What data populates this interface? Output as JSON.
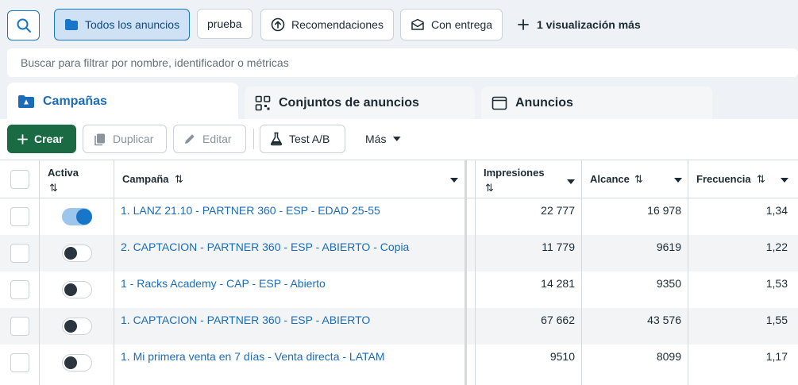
{
  "views": {
    "all_ads": "Todos los anuncios",
    "prueba": "prueba",
    "recomendaciones": "Recomendaciones",
    "con_entrega": "Con entrega",
    "more": "1 visualización más"
  },
  "filter": {
    "placeholder": "Buscar para filtrar por nombre, identificador o métricas"
  },
  "tabs": {
    "campaigns": "Campañas",
    "adsets": "Conjuntos de anuncios",
    "ads": "Anuncios"
  },
  "toolbar": {
    "create": "Crear",
    "duplicate": "Duplicar",
    "edit": "Editar",
    "abtest": "Test A/B",
    "more": "Más"
  },
  "table": {
    "headers": {
      "active": "Activa",
      "campaign": "Campaña",
      "impressions": "Impresiones",
      "reach": "Alcance",
      "frequency": "Frecuencia"
    },
    "sort_glyph": "⇅",
    "rows": [
      {
        "active": true,
        "campaign": "1. LANZ 21.10 - PARTNER 360 - ESP - EDAD 25-55",
        "impressions": "22 777",
        "reach": "16 978",
        "frequency": "1,34"
      },
      {
        "active": false,
        "campaign": "2. CAPTACION - PARTNER 360 - ESP - ABIERTO - Copia",
        "impressions": "11 779",
        "reach": "9619",
        "frequency": "1,22"
      },
      {
        "active": false,
        "campaign": "1 - Racks Academy - CAP - ESP - Abierto",
        "impressions": "14 281",
        "reach": "9350",
        "frequency": "1,53"
      },
      {
        "active": false,
        "campaign": "1. CAPTACION - PARTNER 360 - ESP - ABIERTO",
        "impressions": "67 662",
        "reach": "43 576",
        "frequency": "1,55"
      },
      {
        "active": false,
        "campaign": "1. Mi primera venta en 7 días - Venta directa - LATAM",
        "impressions": "9510",
        "reach": "8099",
        "frequency": "1,17"
      }
    ]
  },
  "colors": {
    "accent": "#1876c8",
    "create": "#1a6b44",
    "link": "#1b6cb8"
  }
}
